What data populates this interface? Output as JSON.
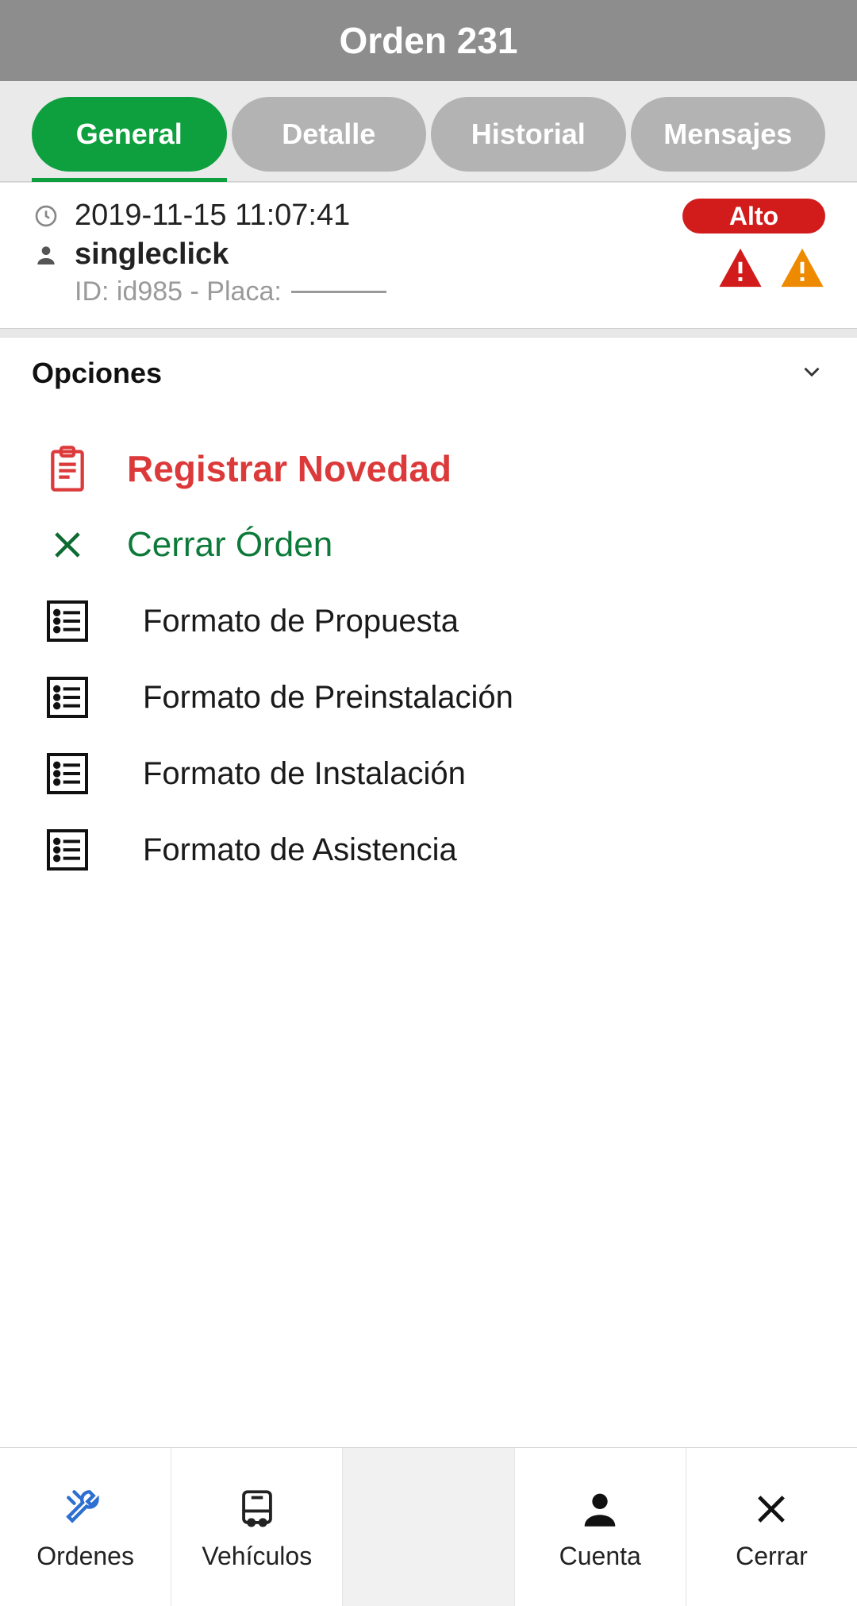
{
  "header": {
    "title": "Orden 231"
  },
  "tabs": [
    {
      "label": "General",
      "active": true
    },
    {
      "label": "Detalle",
      "active": false
    },
    {
      "label": "Historial",
      "active": false
    },
    {
      "label": "Mensajes",
      "active": false
    }
  ],
  "info": {
    "datetime": "2019-11-15 11:07:41",
    "user": "singleclick",
    "sub_prefix": "ID: id985 - Placa:",
    "priority": "Alto"
  },
  "opciones": {
    "title": "Opciones"
  },
  "options": {
    "registrar": "Registrar Novedad",
    "cerrar": "Cerrar Órden",
    "formats": [
      "Formato de Propuesta",
      "Formato de Preinstalación",
      "Formato de Instalación",
      "Formato de Asistencia"
    ]
  },
  "bottom_nav": [
    {
      "label": "Ordenes"
    },
    {
      "label": "Vehículos"
    },
    {
      "label": ""
    },
    {
      "label": "Cuenta"
    },
    {
      "label": "Cerrar"
    }
  ],
  "colors": {
    "primary_green": "#0e9f3e",
    "danger_red": "#d21c1c",
    "warn_orange": "#ee8a00",
    "nav_blue": "#2d6fd2"
  }
}
